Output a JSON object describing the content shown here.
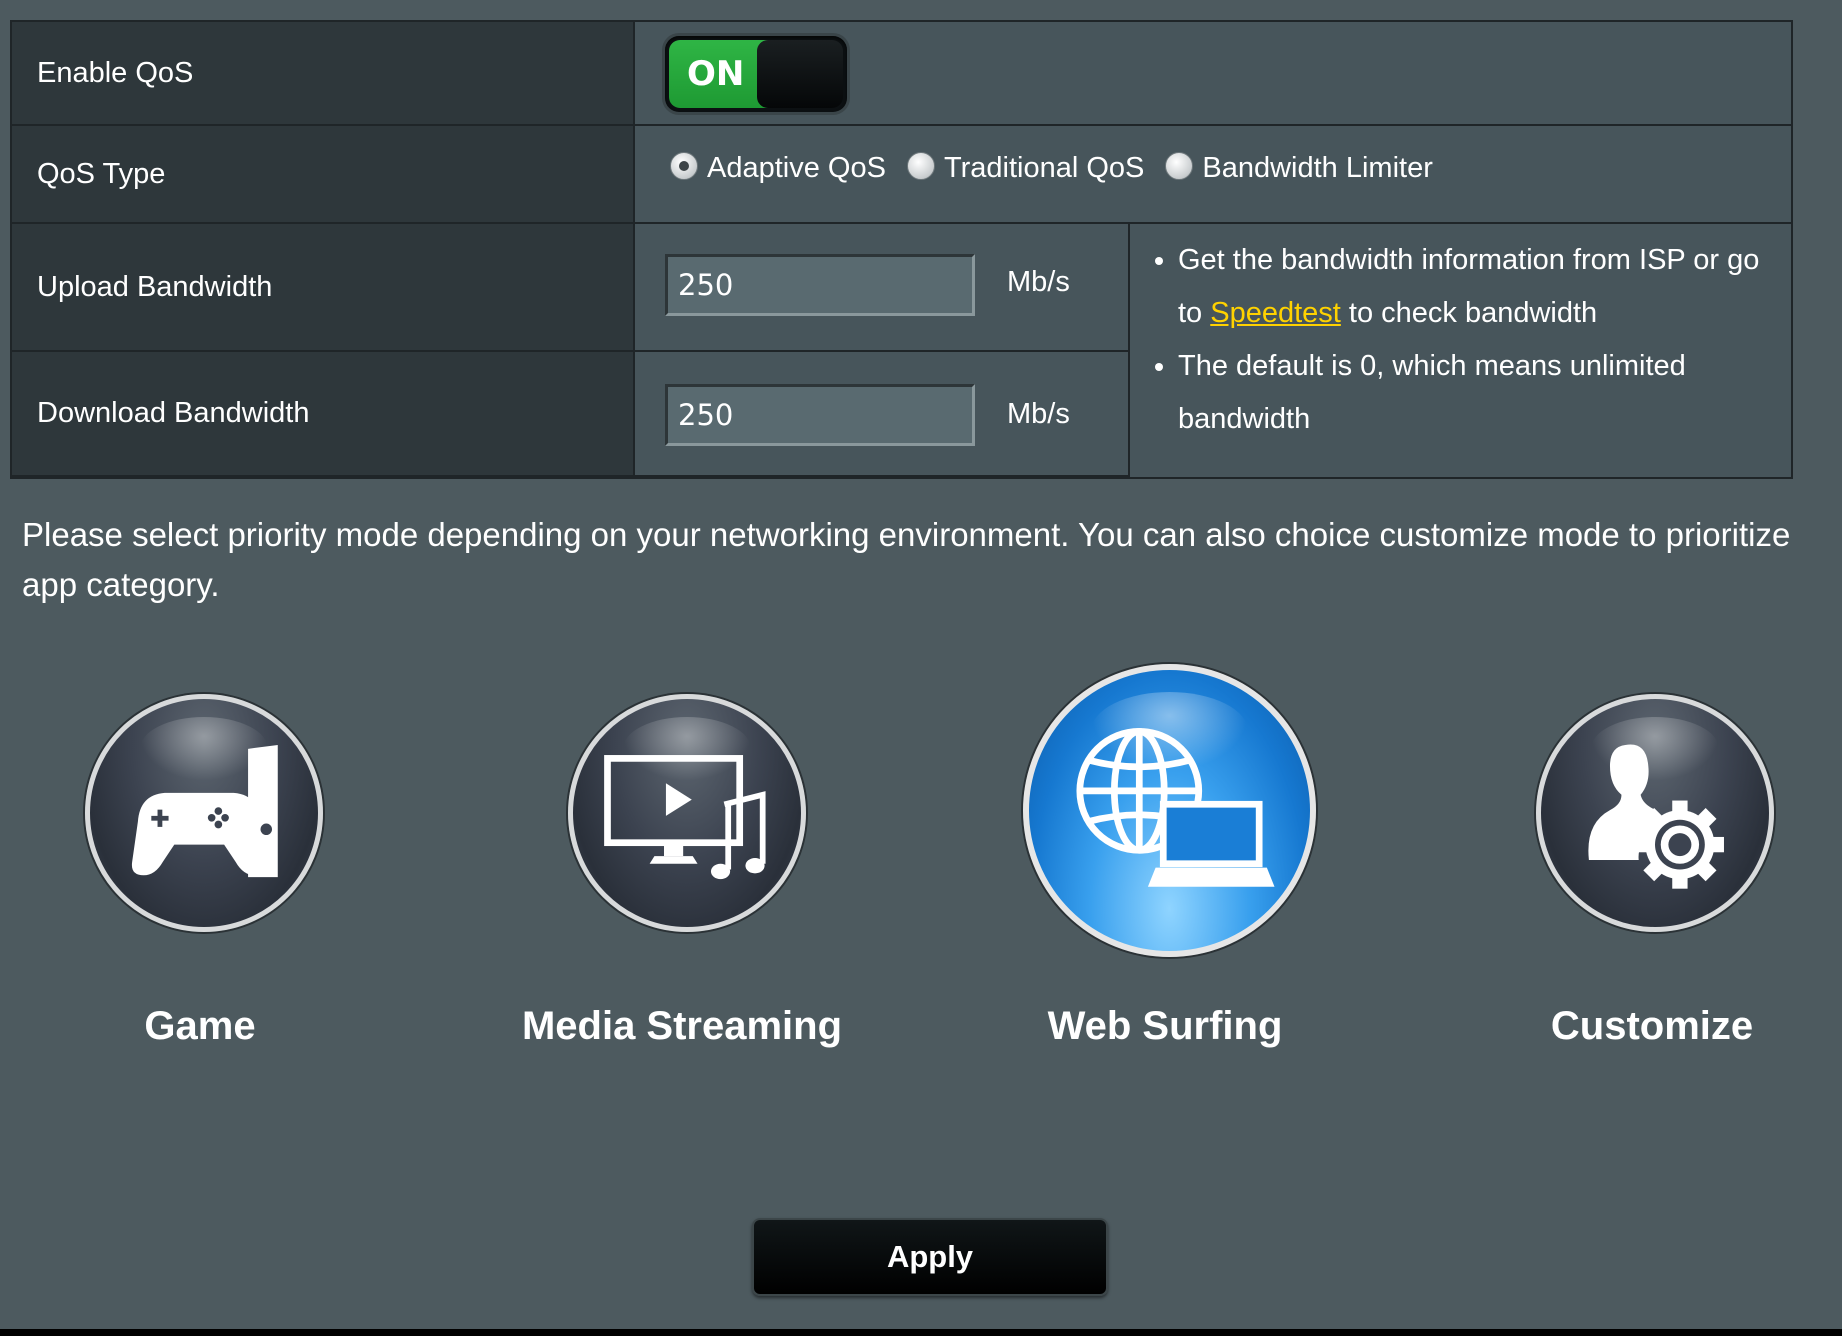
{
  "qos": {
    "enable_label": "Enable QoS",
    "enable_state": "ON",
    "type_label": "QoS Type",
    "types": [
      {
        "label": "Adaptive QoS",
        "checked": true
      },
      {
        "label": "Traditional QoS",
        "checked": false
      },
      {
        "label": "Bandwidth Limiter",
        "checked": false
      }
    ],
    "upload_label": "Upload Bandwidth",
    "upload_value": "250",
    "upload_unit": "Mb/s",
    "download_label": "Download Bandwidth",
    "download_value": "250",
    "download_unit": "Mb/s"
  },
  "help": {
    "item1_prefix": "Get the bandwidth information from ISP or go to ",
    "item1_link": "Speedtest",
    "item1_suffix": " to check bandwidth",
    "item2": "The default is 0, which means unlimited bandwidth"
  },
  "description": "Please select priority mode depending on your networking environment. You can also choice customize mode to prioritize app category.",
  "modes": [
    {
      "label": "Game",
      "icon": "game-console-icon",
      "active": false
    },
    {
      "label": "Media Streaming",
      "icon": "media-streaming-icon",
      "active": false
    },
    {
      "label": "Web Surfing",
      "icon": "web-surfing-icon",
      "active": true
    },
    {
      "label": "Customize",
      "icon": "customize-user-gear-icon",
      "active": false
    }
  ],
  "apply_label": "Apply",
  "colors": {
    "background": "#4d5a5f",
    "label_cell": "#2e373b",
    "value_cell": "#47555b",
    "toggle_on": "#2fb545",
    "link": "#ffd200",
    "active_mode": "#1678d0"
  }
}
